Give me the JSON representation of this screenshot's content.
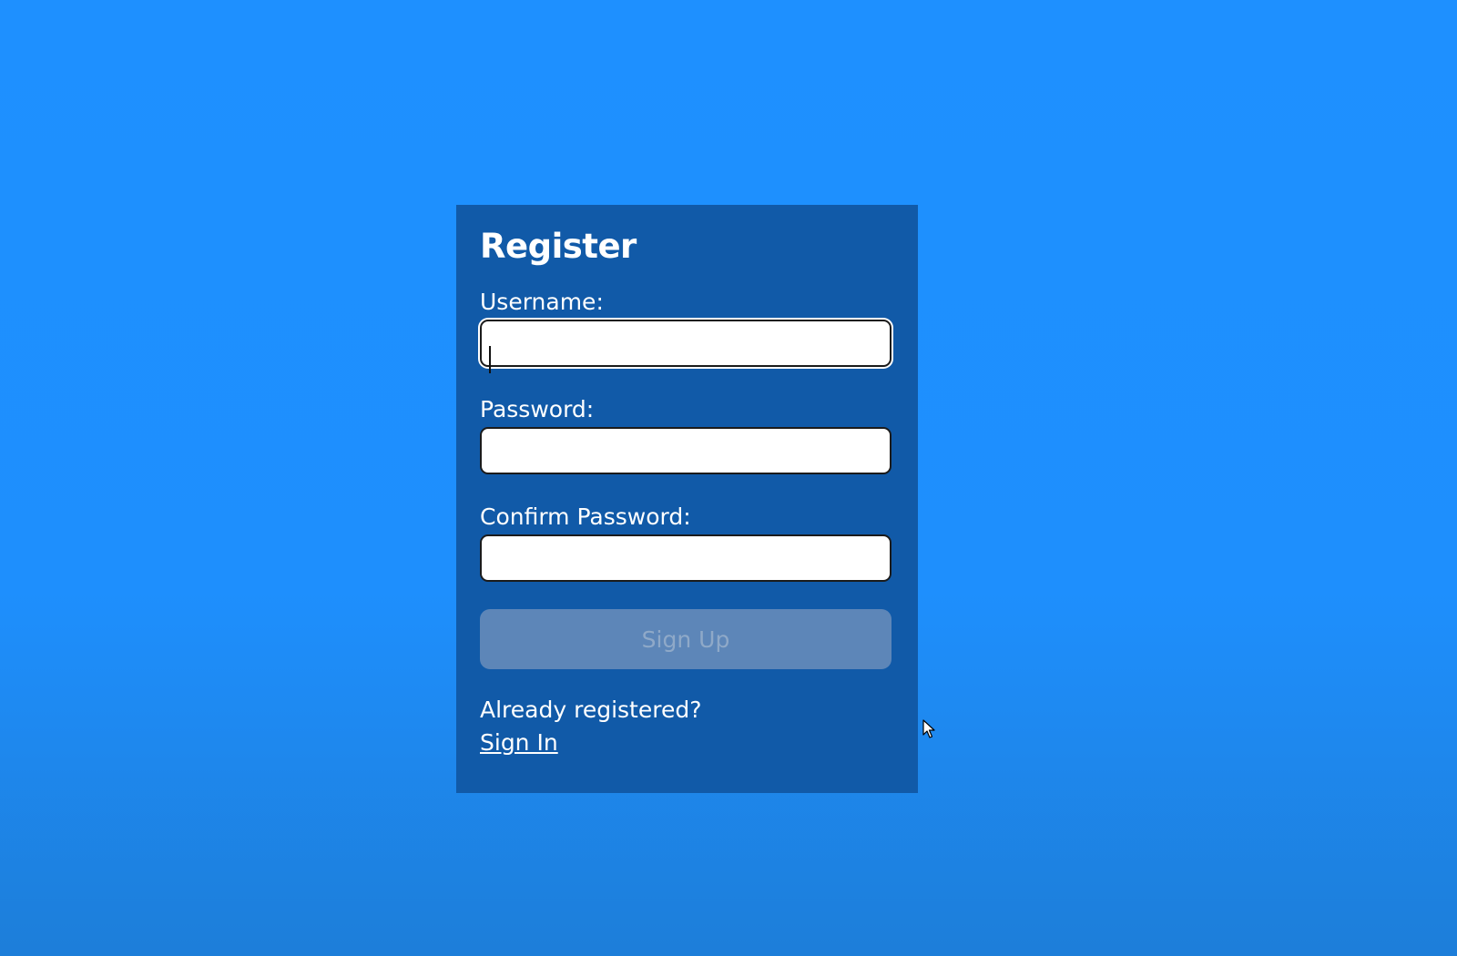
{
  "form": {
    "title": "Register",
    "username_label": "Username:",
    "username_value": "",
    "password_label": "Password:",
    "password_value": "",
    "confirm_label": "Confirm Password:",
    "confirm_value": "",
    "signup_label": "Sign Up",
    "already_text": "Already registered?",
    "signin_label": "Sign In"
  },
  "colors": {
    "background": "#1e90ff",
    "card": "#115aa8",
    "button_disabled": "#5d86b8",
    "text": "#ffffff"
  },
  "icons": {
    "cursor": "mouse-pointer-icon"
  }
}
